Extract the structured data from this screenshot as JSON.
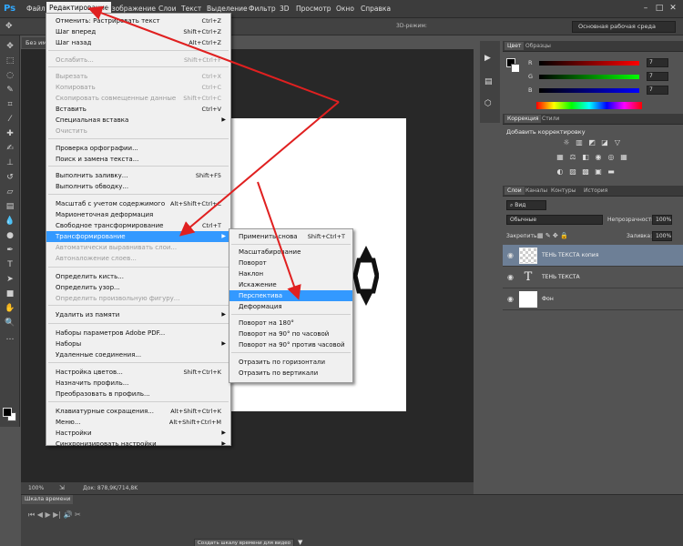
{
  "app": {
    "logo": "Ps"
  },
  "menubar": {
    "items": [
      "Файл",
      "Редактирование",
      "Изображение",
      "Слои",
      "Текст",
      "Выделение",
      "Фильтр",
      "3D",
      "Просмотр",
      "Окно",
      "Справка"
    ],
    "active": "Редактирование"
  },
  "options_bar": {
    "mode_label": "3D-режим:",
    "workspace": "Основная рабочая среда"
  },
  "document": {
    "tab": "Без имени",
    "status_zoom": "100%",
    "status_doc": "Док: 878,9K/714,8K",
    "canvas_color": "#ffffff"
  },
  "edit_menu": {
    "items": [
      {
        "label": "Отменить: Растрировать текст",
        "shortcut": "Ctrl+Z"
      },
      {
        "label": "Шаг вперед",
        "shortcut": "Shift+Ctrl+Z"
      },
      {
        "label": "Шаг назад",
        "shortcut": "Alt+Ctrl+Z"
      },
      {
        "label": "Ослабить...",
        "shortcut": "Shift+Ctrl+F",
        "disabled": true
      },
      {
        "label": "Вырезать",
        "shortcut": "Ctrl+X",
        "disabled": true
      },
      {
        "label": "Копировать",
        "shortcut": "Ctrl+C",
        "disabled": true
      },
      {
        "label": "Скопировать совмещенные данные",
        "shortcut": "Shift+Ctrl+C",
        "disabled": true
      },
      {
        "label": "Вставить",
        "shortcut": "Ctrl+V"
      },
      {
        "label": "Специальная вставка",
        "submenu": true
      },
      {
        "label": "Очистить",
        "disabled": true
      },
      {
        "label": "Проверка орфографии..."
      },
      {
        "label": "Поиск и замена текста..."
      },
      {
        "label": "Выполнить заливку...",
        "shortcut": "Shift+F5"
      },
      {
        "label": "Выполнить обводку..."
      },
      {
        "label": "Масштаб с учетом содержимого",
        "shortcut": "Alt+Shift+Ctrl+C"
      },
      {
        "label": "Марионеточная деформация"
      },
      {
        "label": "Свободное трансформирование",
        "shortcut": "Ctrl+T"
      },
      {
        "label": "Трансформирование",
        "submenu": true,
        "highlighted": true
      },
      {
        "label": "Автоматически выравнивать слои...",
        "disabled": true
      },
      {
        "label": "Автоналожение слоев...",
        "disabled": true
      },
      {
        "label": "Определить кисть..."
      },
      {
        "label": "Определить узор..."
      },
      {
        "label": "Определить произвольную фигуру...",
        "disabled": true
      },
      {
        "label": "Удалить из памяти",
        "submenu": true
      },
      {
        "label": "Наборы параметров Adobe PDF..."
      },
      {
        "label": "Наборы",
        "submenu": true
      },
      {
        "label": "Удаленные соединения..."
      },
      {
        "label": "Настройка цветов...",
        "shortcut": "Shift+Ctrl+K"
      },
      {
        "label": "Назначить профиль..."
      },
      {
        "label": "Преобразовать в профиль..."
      },
      {
        "label": "Клавиатурные сокращения...",
        "shortcut": "Alt+Shift+Ctrl+K"
      },
      {
        "label": "Меню...",
        "shortcut": "Alt+Shift+Ctrl+M"
      },
      {
        "label": "Настройки",
        "submenu": true
      },
      {
        "label": "Синхронизировать настройки",
        "submenu": true
      }
    ]
  },
  "transform_menu": {
    "items": [
      {
        "label": "Применить снова",
        "shortcut": "Shift+Ctrl+T"
      },
      {
        "label": "Масштабирование"
      },
      {
        "label": "Поворот"
      },
      {
        "label": "Наклон"
      },
      {
        "label": "Искажение"
      },
      {
        "label": "Перспектива",
        "highlighted": true
      },
      {
        "label": "Деформация"
      },
      {
        "label": "Поворот на 180°"
      },
      {
        "label": "Поворот на 90° по часовой"
      },
      {
        "label": "Поворот на 90° против часовой"
      },
      {
        "label": "Отразить по горизонтали"
      },
      {
        "label": "Отразить по вертикали"
      }
    ]
  },
  "color_panel": {
    "tabs": [
      "Цвет",
      "Образцы"
    ],
    "channels": [
      {
        "label": "R",
        "value": "7",
        "gradient": "#ff0000"
      },
      {
        "label": "G",
        "value": "7",
        "gradient": "#00ff00"
      },
      {
        "label": "B",
        "value": "7",
        "gradient": "#0000ff"
      }
    ]
  },
  "adjustments_panel": {
    "tabs": [
      "Коррекция",
      "Стили"
    ],
    "title": "Добавить корректировку"
  },
  "layers_panel": {
    "tabs": [
      "Слои",
      "Каналы",
      "Контуры",
      "История"
    ],
    "kind_filter": "Вид",
    "blend_mode": "Обычные",
    "opacity_label": "Непрозрачность:",
    "opacity_value": "100%",
    "lock_label": "Закрепить:",
    "fill_label": "Заливка:",
    "fill_value": "100%",
    "layers": [
      {
        "name": "ТЕНЬ ТЕКСТА копия",
        "selected": true,
        "type": "raster"
      },
      {
        "name": "ТЕНЬ ТЕКСТА",
        "type": "text"
      },
      {
        "name": "Фон",
        "type": "background"
      }
    ]
  },
  "timeline": {
    "tab": "Шкала времени",
    "create_button": "Создать шкалу времени для видео"
  },
  "colors": {
    "highlight": "#3399ff",
    "arrow": "#e02020",
    "selected_layer": "#6d7f96"
  }
}
